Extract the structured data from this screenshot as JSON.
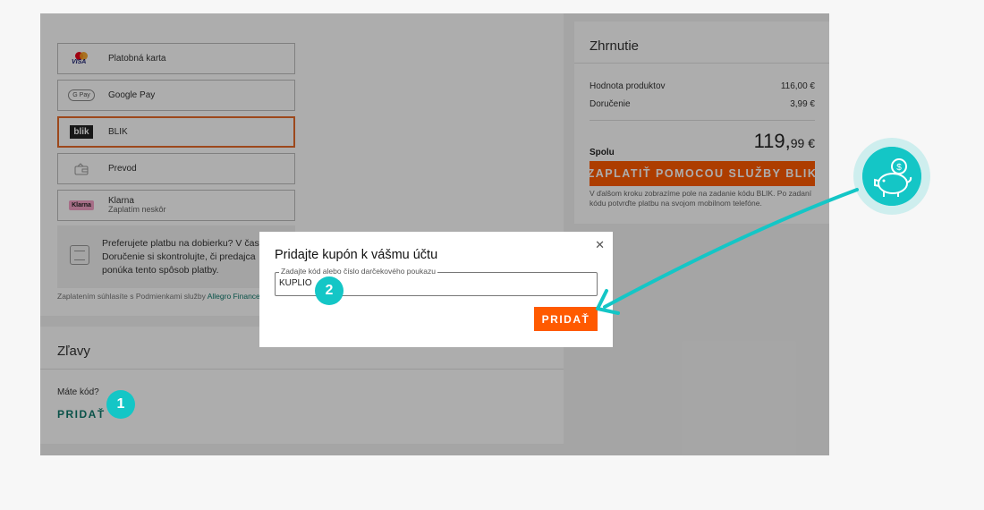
{
  "payment_methods": [
    {
      "name": "Platobná karta",
      "sub": "",
      "icon": "card-icon"
    },
    {
      "name": "Google Pay",
      "sub": "",
      "icon": "gpay-icon"
    },
    {
      "name": "BLIK",
      "sub": "",
      "icon": "blik-icon",
      "selected": true
    },
    {
      "name": "Prevod",
      "sub": "",
      "icon": "transfer-icon"
    },
    {
      "name": "Klarna",
      "sub": "Zaplatím neskôr",
      "icon": "klarna-icon"
    }
  ],
  "logos": {
    "visa": "VISA",
    "gpay": "G Pay",
    "blik": "blik",
    "klarna": "Klarna"
  },
  "cod": {
    "line1": "Preferujete platbu na dobierku? V časti",
    "line2": "Doručenie si skontrolujte, či predajca",
    "line3": "ponúka tento spôsob platby."
  },
  "terms": {
    "text": "Zaplatením súhlasíte s Podmienkami služby ",
    "link": "Allegro Finance"
  },
  "discounts": {
    "title": "Zľavy",
    "have_code": "Máte kód?",
    "add_label": "PRIDAŤ"
  },
  "summary": {
    "title": "Zhrnutie",
    "rows": [
      {
        "label": "Hodnota produktov",
        "value": "116,00 €"
      },
      {
        "label": "Doručenie",
        "value": "3,99 €"
      }
    ],
    "total_label": "Spolu",
    "total_main": "119,",
    "total_cents": "99 €",
    "pay_button": "ZAPLATIŤ POMOCOU SLUŽBY BLIK",
    "note": "V ďalšom kroku zobrazíme pole na zadanie kódu BLIK. Po zadaní kódu potvrďte platbu na svojom mobilnom telefóne."
  },
  "modal": {
    "title": "Pridajte kupón k vášmu účtu",
    "field_label": "Zadajte kód alebo číslo darčekového poukazu",
    "field_value": "KUPLIO",
    "add_button": "PRIDAŤ",
    "close_icon": "close-icon"
  },
  "steps": {
    "step1": "1",
    "step2": "2"
  },
  "colors": {
    "accent_orange": "#ff5a00",
    "teal": "#14c6c6",
    "link_green": "#0f7a6c",
    "selected_border": "#e86a2a"
  }
}
